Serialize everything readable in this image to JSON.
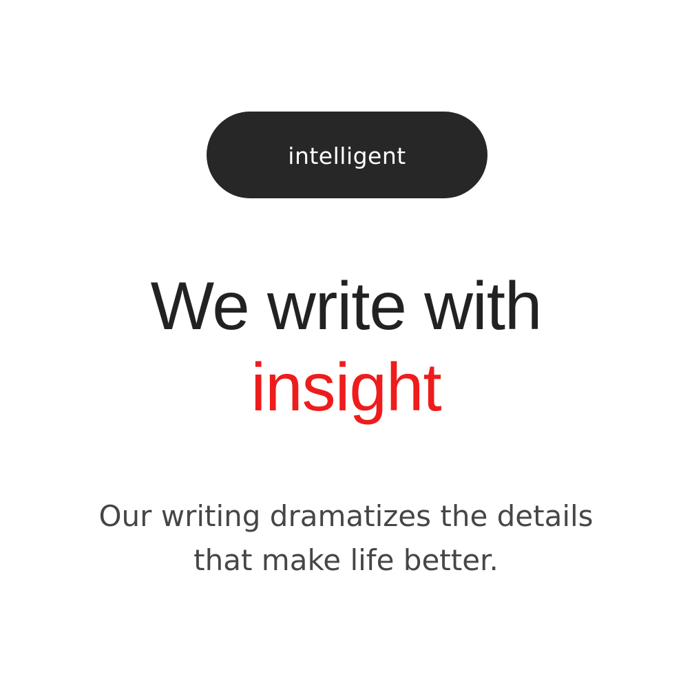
{
  "badge": {
    "label": "intelligent"
  },
  "headline": {
    "line1": "We write with",
    "line2": "insight"
  },
  "description": {
    "line1": "Our writing dramatizes the details",
    "line2": "that make life better."
  },
  "colors": {
    "background": "#ffffff",
    "badge_background": "#272727",
    "headline_text": "#222222",
    "accent": "#ee1c1c",
    "body_text": "#464646"
  }
}
